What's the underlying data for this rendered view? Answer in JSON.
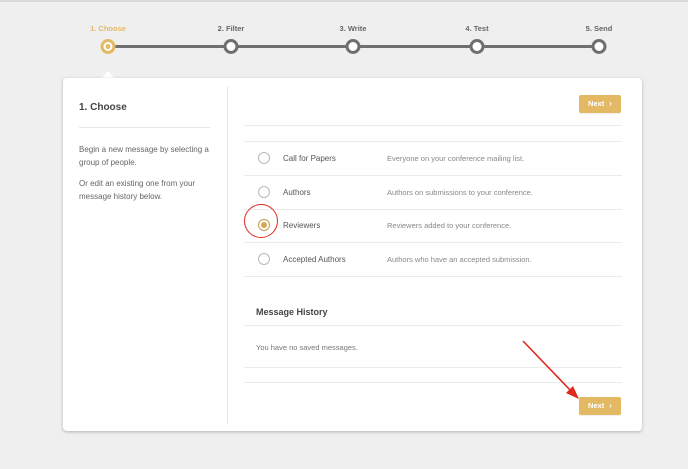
{
  "stepper": {
    "steps": [
      {
        "label": "1. Choose",
        "active": true
      },
      {
        "label": "2. Filter",
        "active": false
      },
      {
        "label": "3. Write",
        "active": false
      },
      {
        "label": "4. Test",
        "active": false
      },
      {
        "label": "5. Send",
        "active": false
      }
    ]
  },
  "left_panel": {
    "title": "1. Choose",
    "paragraph_1": "Begin a new message by selecting a group of people.",
    "paragraph_2": "Or edit an existing one from your message history below."
  },
  "buttons": {
    "next_top": "Next",
    "next_bottom": "Next",
    "chevron": "›"
  },
  "recipients": {
    "selected": "Reviewers",
    "options": [
      {
        "name": "Call for Papers",
        "description": "Everyone on your conference mailing list."
      },
      {
        "name": "Authors",
        "description": "Authors on submissions to your conference."
      },
      {
        "name": "Reviewers",
        "description": "Reviewers added to your conference."
      },
      {
        "name": "Accepted Authors",
        "description": "Authors who have an accepted submission."
      }
    ]
  },
  "message_history": {
    "title": "Message History",
    "empty_text": "You have no saved messages."
  },
  "colors": {
    "accent": "#e3b964",
    "annotation": "#e0281d"
  }
}
